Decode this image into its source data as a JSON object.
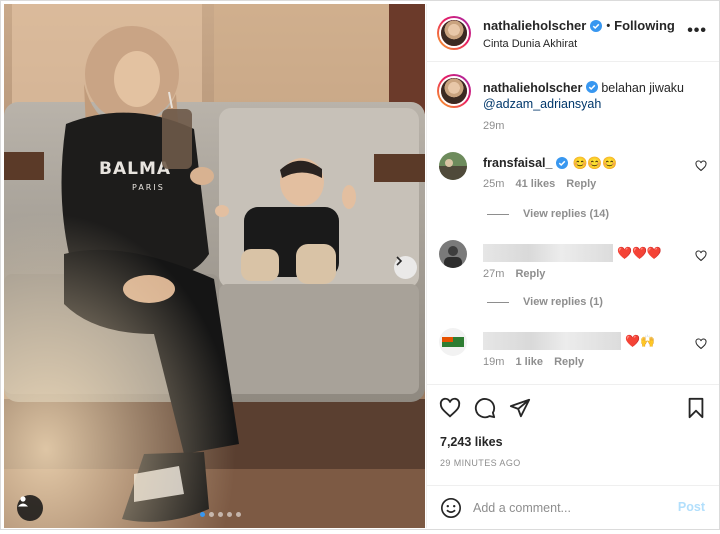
{
  "post": {
    "image_alt": "",
    "carousel_dot_count": 5,
    "carousel_active_index": 0
  },
  "header": {
    "username": "nathalieholscher",
    "follow_separator": "•",
    "follow_label": "Following",
    "location": "Cinta Dunia Akhirat",
    "more_icon": "more-horizontal-icon",
    "more_label": "•••"
  },
  "caption": {
    "username": "nathalieholscher",
    "text": "belahan jiwaku",
    "mention": "@adzam_adriansyah",
    "time": "29m"
  },
  "comments": [
    {
      "username": "fransfaisal_",
      "verified": true,
      "text": "😊😊😊",
      "time": "25m",
      "likes": "41 likes",
      "reply_label": "Reply",
      "view_replies": "View replies (14)"
    },
    {
      "username_hidden": true,
      "text": "❤️❤️❤️",
      "time": "27m",
      "reply_label": "Reply",
      "view_replies": "View replies (1)"
    },
    {
      "username_hidden": true,
      "text": "❤️🙌",
      "time": "19m",
      "likes": "1 like",
      "reply_label": "Reply"
    }
  ],
  "actions": {
    "icons": [
      "heart-icon",
      "comment-icon",
      "share-icon",
      "bookmark-icon"
    ],
    "likes": "7,243 likes",
    "time_ago": "29 MINUTES AGO"
  },
  "add_comment": {
    "placeholder": "Add a comment...",
    "post_label": "Post"
  },
  "colors": {
    "verified": "#3897f0",
    "link": "#00376b",
    "muted": "#8e8e8e",
    "post_disabled": "#b2dffc"
  }
}
